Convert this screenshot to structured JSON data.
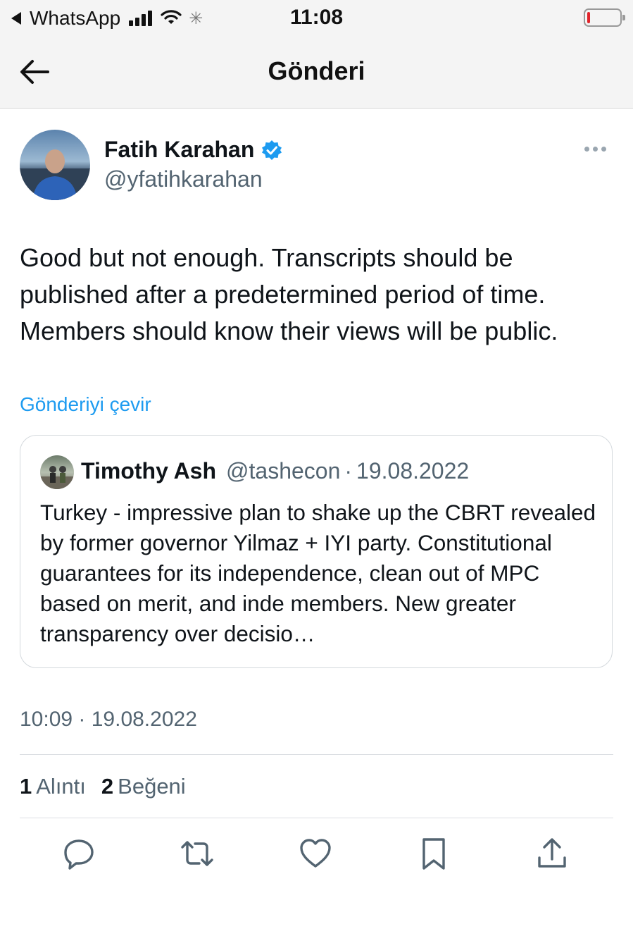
{
  "status_bar": {
    "back_app": "WhatsApp",
    "time": "11:08",
    "loading_glyph": "✳",
    "icons": [
      "back-triangle-icon",
      "signal-icon",
      "wifi-icon",
      "loading-icon",
      "battery-icon"
    ],
    "battery_level": 0.1,
    "battery_color": "#e0242b"
  },
  "header": {
    "title": "Gönderi",
    "back_icon": "arrow-left-icon"
  },
  "tweet": {
    "author_name": "Fatih Karahan",
    "author_handle": "@yfatihkarahan",
    "verified_icon": "verified-badge-icon",
    "more_icon": "more-icon",
    "text": "Good but not enough. Transcripts should be published after a predetermined period of time. Members should know their views will be public.",
    "translate_label": "Gönderiyi çevir",
    "timestamp": "10:09 · 19.08.2022"
  },
  "quote": {
    "author_name": "Timothy Ash",
    "author_handle": "@tashecon",
    "separator": "·",
    "date": "19.08.2022",
    "text": "Turkey - impressive plan to shake up the CBRT revealed by former governor Yilmaz + IYI party. Constitutional guarantees for its independence, clean out of MPC based on merit, and inde members. New greater transparency over decisio…"
  },
  "stats": {
    "quotes_count": "1",
    "quotes_label": "Alıntı",
    "likes_count": "2",
    "likes_label": "Beğeni"
  },
  "actions": [
    "reply-icon",
    "retweet-icon",
    "like-icon",
    "bookmark-icon",
    "share-icon"
  ],
  "colors": {
    "accent": "#1d9bf0",
    "secondary_text": "#536471",
    "primary_text": "#0f1419",
    "icon": "#536471"
  }
}
